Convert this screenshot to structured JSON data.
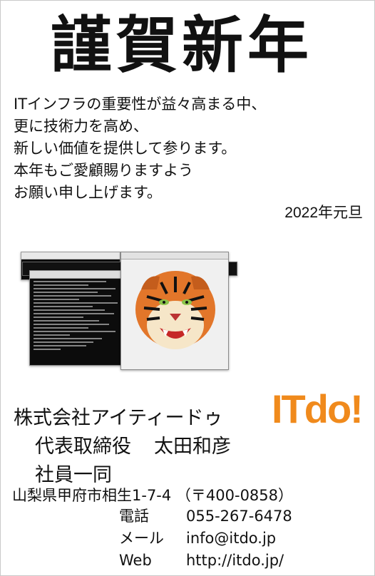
{
  "title": "謹賀新年",
  "greeting": {
    "lines": [
      "ITインフラの重要性が益々高まる中、",
      "更に技術力を高め、",
      "新しい価値を提供して参ります。",
      "本年もご愛顧賜りますよう",
      "お願い申し上げます。"
    ],
    "date": "2022年元旦"
  },
  "logo": {
    "text": "ITdo!",
    "color": "#f08a1c"
  },
  "company": {
    "name": "株式会社アイティードゥ",
    "rep_title": "代表取締役",
    "rep_name": "太田和彦",
    "staff": "社員一同"
  },
  "contact": {
    "address": "山梨県甲府市相生1-7-4 （〒400-0858）",
    "phone_label": "電話",
    "phone": "055-267-6478",
    "mail_label": "メール",
    "mail": "info@itdo.jp",
    "web_label": "Web",
    "web": "http://itdo.jp/"
  }
}
